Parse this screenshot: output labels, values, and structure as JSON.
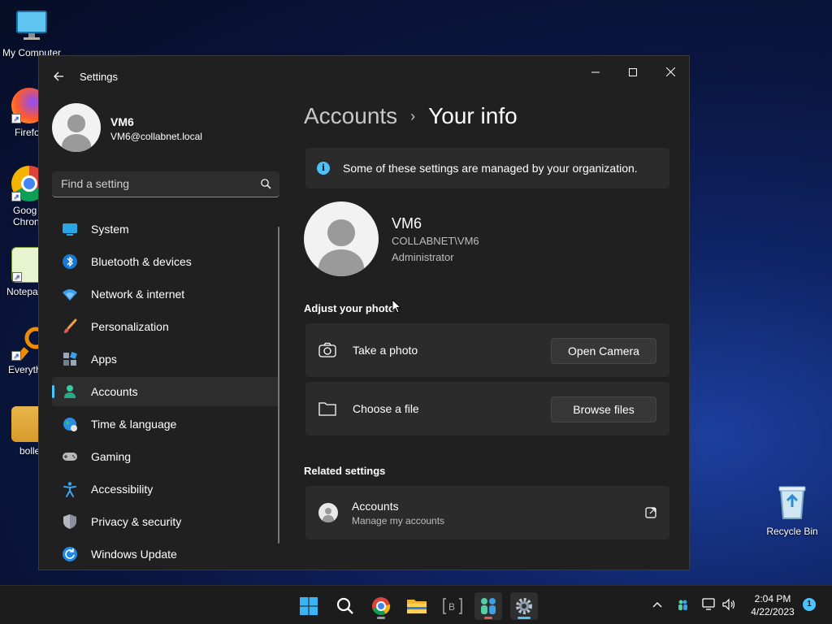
{
  "desktop": {
    "icons": [
      {
        "label": "My Computer",
        "icon": "monitor-icon"
      },
      {
        "label": "Firefo",
        "icon": "firefox-icon"
      },
      {
        "label": "Goog Chron",
        "icon": "chrome-icon"
      },
      {
        "label": "Notepa",
        "icon": "notepad-icon"
      },
      {
        "label": "Everyth",
        "icon": "everything-search-icon"
      },
      {
        "label": "bolle",
        "icon": "folder-icon"
      }
    ],
    "recycle_bin": "Recycle Bin"
  },
  "window": {
    "app_title": "Settings",
    "controls": {
      "minimize": "—",
      "maximize": "☐",
      "close": "✕"
    }
  },
  "sidebar": {
    "profile": {
      "name": "VM6",
      "email": "VM6@collabnet.local"
    },
    "search": {
      "placeholder": "Find a setting"
    },
    "items": [
      {
        "label": "System",
        "icon": "system-icon"
      },
      {
        "label": "Bluetooth & devices",
        "icon": "bluetooth-icon"
      },
      {
        "label": "Network & internet",
        "icon": "wifi-icon"
      },
      {
        "label": "Personalization",
        "icon": "brush-icon"
      },
      {
        "label": "Apps",
        "icon": "apps-icon"
      },
      {
        "label": "Accounts",
        "icon": "accounts-icon",
        "selected": true
      },
      {
        "label": "Time & language",
        "icon": "globe-icon"
      },
      {
        "label": "Gaming",
        "icon": "gamepad-icon"
      },
      {
        "label": "Accessibility",
        "icon": "accessibility-icon"
      },
      {
        "label": "Privacy & security",
        "icon": "shield-icon"
      },
      {
        "label": "Windows Update",
        "icon": "update-icon"
      }
    ]
  },
  "main": {
    "breadcrumb": {
      "parent": "Accounts",
      "separator": "›",
      "current": "Your info"
    },
    "banner": "Some of these settings are managed by your organization.",
    "user": {
      "name": "VM6",
      "domain": "COLLABNET\\VM6",
      "role": "Administrator"
    },
    "adjust_photo": {
      "title": "Adjust your photo",
      "take_photo": {
        "label": "Take a photo",
        "button": "Open Camera"
      },
      "choose_file": {
        "label": "Choose a file",
        "button": "Browse files"
      }
    },
    "related": {
      "title": "Related settings",
      "accounts": {
        "title": "Accounts",
        "subtitle": "Manage my accounts"
      }
    }
  },
  "taskbar": {
    "time": "2:04 PM",
    "date": "4/22/2023",
    "notifications": "1"
  },
  "colors": {
    "accent": "#4cc2ff",
    "window_bg": "#202020",
    "card_bg": "#2b2b2b"
  }
}
